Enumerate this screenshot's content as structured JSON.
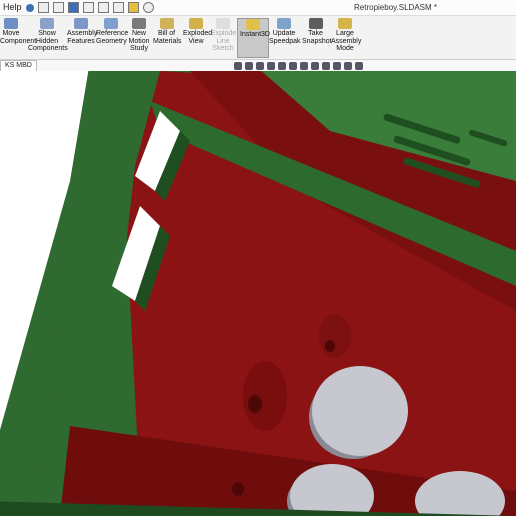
{
  "app": {
    "menu_help": "Help",
    "document_title": "Retropieboy.SLDASM *"
  },
  "ribbon": {
    "buttons": [
      {
        "label": "Move\nComponent",
        "icon": "move-component-icon"
      },
      {
        "label": "Show\nHidden\nComponents",
        "icon": "show-hidden-icon"
      },
      {
        "label": "Assembly\nFeatures",
        "icon": "assembly-features-icon"
      },
      {
        "label": "Reference\nGeometry",
        "icon": "reference-geometry-icon"
      },
      {
        "label": "New\nMotion\nStudy",
        "icon": "motion-study-icon"
      },
      {
        "label": "Bill of\nMaterials",
        "icon": "bom-icon"
      },
      {
        "label": "Exploded\nView",
        "icon": "exploded-view-icon"
      },
      {
        "label": "Explode\nLine\nSketch",
        "icon": "explode-line-icon"
      },
      {
        "label": "Instant3D",
        "icon": "instant3d-icon"
      },
      {
        "label": "Update\nSpeedpak",
        "icon": "speedpak-icon"
      },
      {
        "label": "Take\nSnapshot",
        "icon": "camera-icon"
      },
      {
        "label": "Large\nAssembly\nMode",
        "icon": "large-assembly-icon"
      }
    ]
  },
  "tabs": {
    "active": "KS MBD"
  },
  "colors": {
    "green_frame": "#2f6a30",
    "red_body": "#8b1313",
    "grey_button": "#c7c7d0"
  }
}
